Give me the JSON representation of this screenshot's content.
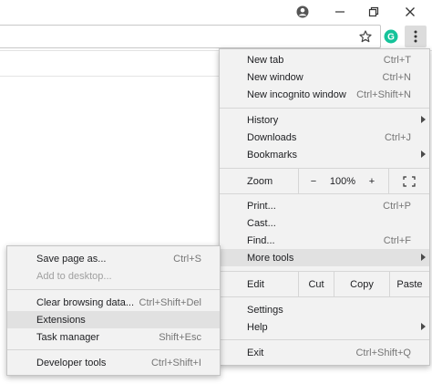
{
  "window": {
    "account_icon": "account-circle-icon",
    "minimize_icon": "minimize-icon",
    "restore_icon": "restore-icon",
    "close_icon": "close-icon"
  },
  "toolbar": {
    "bookmark_icon": "star-outline-icon",
    "extension_icon": "grammarly-g-icon",
    "extension_color": "#15C39A",
    "menu_icon": "kebab-menu-icon"
  },
  "main_menu": {
    "new_tab": {
      "label": "New tab",
      "shortcut": "Ctrl+T"
    },
    "new_window": {
      "label": "New window",
      "shortcut": "Ctrl+N"
    },
    "new_incognito": {
      "label": "New incognito window",
      "shortcut": "Ctrl+Shift+N"
    },
    "history": {
      "label": "History"
    },
    "downloads": {
      "label": "Downloads",
      "shortcut": "Ctrl+J"
    },
    "bookmarks": {
      "label": "Bookmarks"
    },
    "zoom": {
      "label": "Zoom",
      "minus": "−",
      "value": "100%",
      "plus": "+"
    },
    "print": {
      "label": "Print...",
      "shortcut": "Ctrl+P"
    },
    "cast": {
      "label": "Cast..."
    },
    "find": {
      "label": "Find...",
      "shortcut": "Ctrl+F"
    },
    "more_tools": {
      "label": "More tools"
    },
    "edit": {
      "label": "Edit",
      "cut": "Cut",
      "copy": "Copy",
      "paste": "Paste"
    },
    "settings": {
      "label": "Settings"
    },
    "help": {
      "label": "Help"
    },
    "exit": {
      "label": "Exit",
      "shortcut": "Ctrl+Shift+Q"
    }
  },
  "more_tools_menu": {
    "save_page": {
      "label": "Save page as...",
      "shortcut": "Ctrl+S"
    },
    "add_to_desktop": {
      "label": "Add to desktop..."
    },
    "clear_browsing": {
      "label": "Clear browsing data...",
      "shortcut": "Ctrl+Shift+Del"
    },
    "extensions": {
      "label": "Extensions"
    },
    "task_manager": {
      "label": "Task manager",
      "shortcut": "Shift+Esc"
    },
    "developer_tools": {
      "label": "Developer tools",
      "shortcut": "Ctrl+Shift+I"
    }
  }
}
